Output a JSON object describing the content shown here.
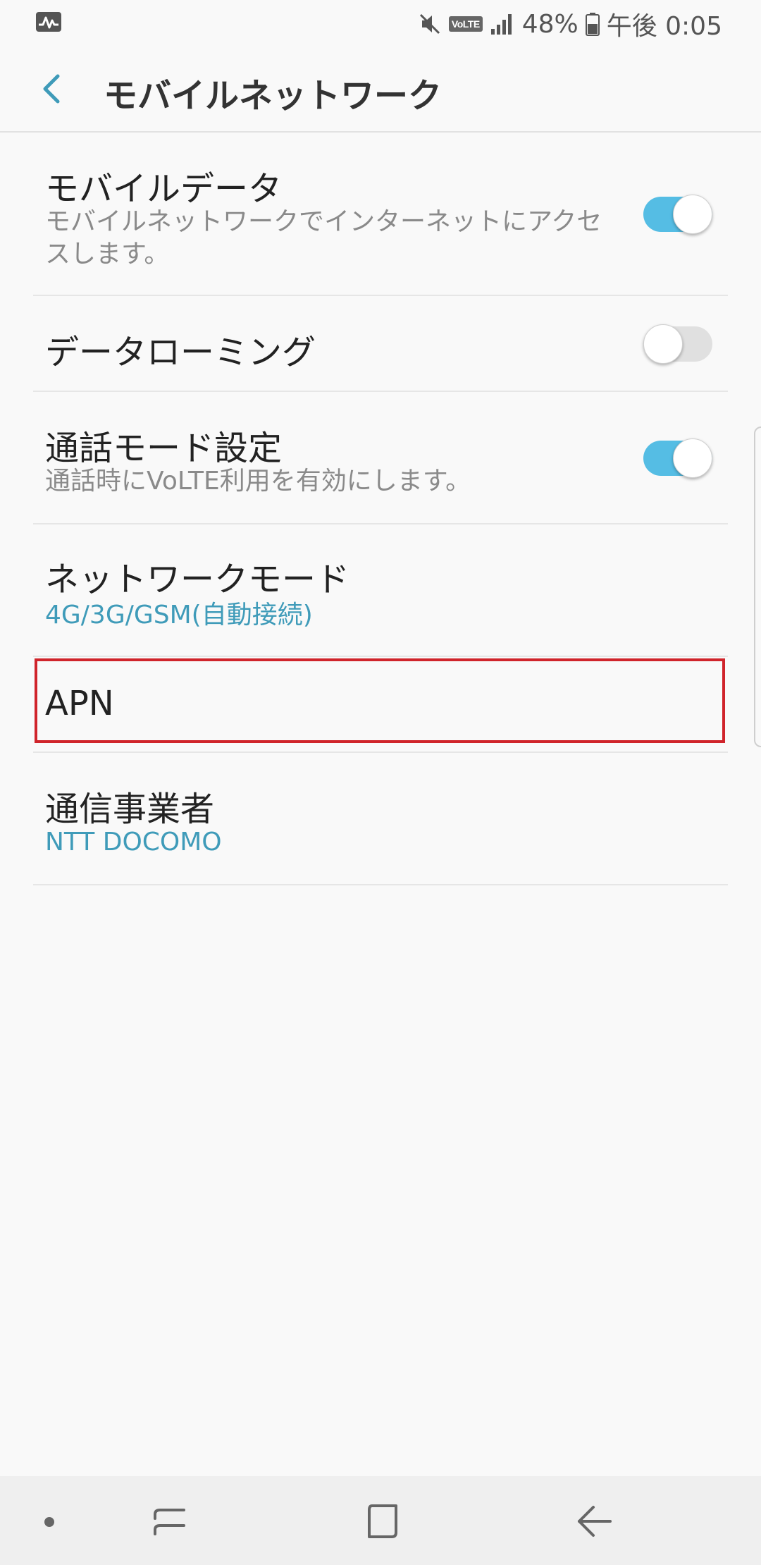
{
  "status_bar": {
    "icons": [
      "activity-icon",
      "mute-icon",
      "volte-icon",
      "signal-icon",
      "battery-icon"
    ],
    "volte_label": "VoLTE",
    "battery": "48%",
    "time": "午後 0:05"
  },
  "header": {
    "back_icon": "chevron-left-icon",
    "title": "モバイルネットワーク"
  },
  "settings": {
    "mobile_data": {
      "title": "モバイルデータ",
      "subtitle": "モバイルネットワークでインターネットにアクセスします。",
      "enabled": true
    },
    "data_roaming": {
      "title": "データローミング",
      "enabled": false
    },
    "call_mode": {
      "title": "通話モード設定",
      "subtitle": "通話時にVoLTE利用を有効にします。",
      "enabled": true
    },
    "network_mode": {
      "title": "ネットワークモード",
      "value": "4G/3G/GSM(自動接続)"
    },
    "apn": {
      "title": "APN"
    },
    "carrier": {
      "title": "通信事業者",
      "value": "NTT DOCOMO"
    }
  },
  "colors": {
    "accent": "#3f9bb9",
    "toggle_on": "#55bde4",
    "highlight": "#d0242b",
    "background": "#f9f9f9"
  },
  "nav_bar": {
    "icons": [
      "dot-icon",
      "recent-apps-icon",
      "home-icon",
      "back-arrow-icon"
    ]
  }
}
